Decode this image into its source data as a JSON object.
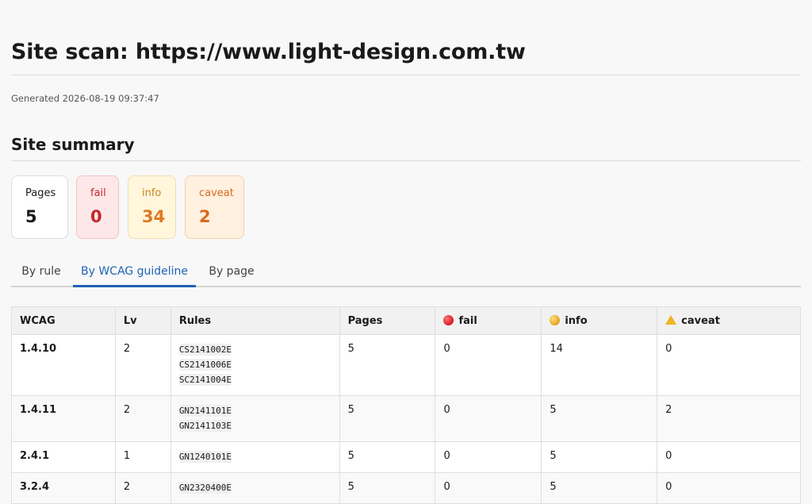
{
  "header": {
    "title": "Site scan: https://www.light-design.com.tw",
    "generated": "Generated 2026-08-19 09:37:47"
  },
  "summary": {
    "title": "Site summary",
    "cards": {
      "pages": {
        "label": "Pages",
        "value": "5"
      },
      "fail": {
        "label": "fail",
        "value": "0"
      },
      "info": {
        "label": "info",
        "value": "34"
      },
      "caveat": {
        "label": "caveat",
        "value": "2"
      }
    }
  },
  "tabs": {
    "by_rule": "By rule",
    "by_wcag": "By WCAG guideline",
    "by_page": "By page",
    "active": "By WCAG guideline"
  },
  "table": {
    "headers": {
      "wcag": "WCAG",
      "lv": "Lv",
      "rules": "Rules",
      "pages": "Pages",
      "fail": "fail",
      "info": "info",
      "caveat": "caveat"
    },
    "rows": [
      {
        "wcag": "1.4.10",
        "lv": "2",
        "rules": [
          "CS2141002E",
          "CS2141006E",
          "SC2141004E"
        ],
        "pages": "5",
        "fail": "0",
        "info": "14",
        "caveat": "0"
      },
      {
        "wcag": "1.4.11",
        "lv": "2",
        "rules": [
          "GN2141101E",
          "GN2141103E"
        ],
        "pages": "5",
        "fail": "0",
        "info": "5",
        "caveat": "2"
      },
      {
        "wcag": "2.4.1",
        "lv": "1",
        "rules": [
          "GN1240101E"
        ],
        "pages": "5",
        "fail": "0",
        "info": "5",
        "caveat": "0"
      },
      {
        "wcag": "3.2.4",
        "lv": "2",
        "rules": [
          "GN2320400E"
        ],
        "pages": "5",
        "fail": "0",
        "info": "5",
        "caveat": "0"
      }
    ]
  },
  "colors": {
    "accent": "#1f63b5",
    "fail": "#c0282d",
    "info": "#e07a1f",
    "caveat": "#d9691f"
  },
  "icons": {
    "fail": "red-circle-icon",
    "info": "yellow-circle-icon",
    "caveat": "warning-icon"
  }
}
